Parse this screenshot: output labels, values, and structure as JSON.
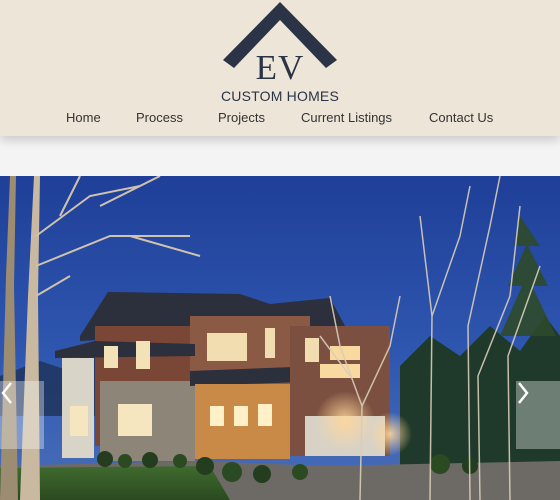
{
  "logo": {
    "monogram": "EV",
    "subtitle": "CUSTOM HOMES"
  },
  "nav": {
    "items": [
      {
        "label": "Home"
      },
      {
        "label": "Process"
      },
      {
        "label": "Projects"
      },
      {
        "label": "Current Listings"
      },
      {
        "label": "Contact Us"
      }
    ]
  },
  "hero": {
    "image": "house-at-dusk-photo",
    "prev_icon": "chevron-left-icon",
    "next_icon": "chevron-right-icon"
  },
  "colors": {
    "header_bg": "#ede5d8",
    "brand_navy": "#2b3446",
    "nav_text": "#333333",
    "sky": "#2a4ea0"
  }
}
